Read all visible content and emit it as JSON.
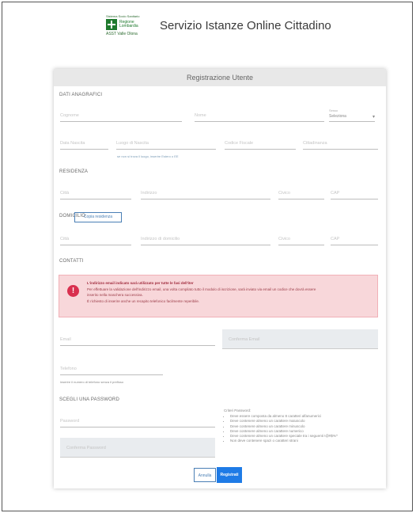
{
  "header": {
    "logo_top": "Sistema Socio Sanitario",
    "logo_name_1": "Regione",
    "logo_name_2": "Lombardia",
    "logo_bottom": "ASST Valle Olona",
    "title": "Servizio Istanze Online Cittadino"
  },
  "form": {
    "title": "Registrazione Utente",
    "anagrafici": {
      "title": "DATI ANAGRAFICI",
      "cognome": "Cognome",
      "nome": "Nome",
      "sesso_label": "Sesso",
      "sesso_value": "Seleziona",
      "data_nascita": "Data Nascita",
      "luogo_nascita": "Luogo di Nascita",
      "luogo_hint": "se non si trova il luogo, inserire Estero o EE",
      "codice_fiscale": "Codice Fiscale",
      "cittadinanza": "Cittadinanza"
    },
    "residenza": {
      "title": "RESIDENZA",
      "citta": "Città",
      "indirizzo": "Indirizzo",
      "civico": "Civico",
      "cap": "CAP"
    },
    "domicilio": {
      "title": "DOMICILIO",
      "copy_button": "Copia residenza",
      "citta": "Città",
      "indirizzo": "Indirizzo di domicilio",
      "civico": "Civico",
      "cap": "CAP"
    },
    "contatti": {
      "title": "CONTATTI",
      "alert_line1": "L'indirizzo email indicato sarà utilizzato per tutte le fasi dell'iter",
      "alert_line2": "Per effettuare la validazione dell'indirizzo email, una volta compilato tutto il modulo di iscrizione, sarà inviato via email un codice che dovrà essere",
      "alert_line3": "inserito nella maschera successiva.",
      "alert_line4": "È richiesto di inserire anche un recapito telefonico facilmente reperibile.",
      "email": "Email",
      "conferma_email": "Conferma Email",
      "telefono": "Telefono",
      "telefono_hint": "inserire il numero di telefono senza il prefisso"
    },
    "password": {
      "title": "SCEGLI UNA PASSWORD",
      "password": "Password",
      "conferma_password": "Conferma Password",
      "rules_title": "Criteri Password:",
      "rules": [
        "Deve essere composta da almeno 8 caratteri alfanumerici",
        "Deve contenere almeno un carattere maiuscolo",
        "Deve contenere almeno un carattere minuscolo",
        "Deve contenere almeno un carattere numerico",
        "Deve contenere almeno un carattere speciale tra i seguenti !@#$%^",
        "Non deve contenere spazi o caratteri strani"
      ]
    },
    "buttons": {
      "annulla": "Annulla",
      "registrati": "Registrati"
    }
  }
}
